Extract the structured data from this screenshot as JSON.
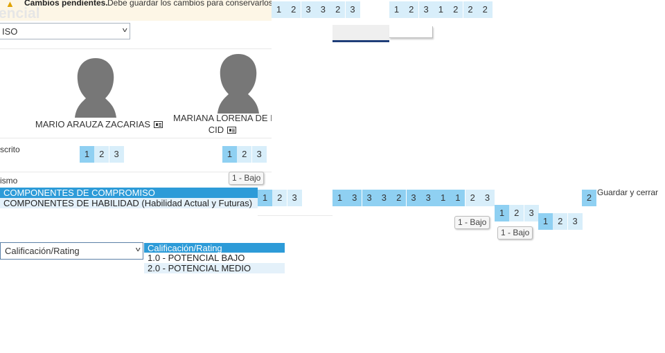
{
  "banner": {
    "warning_icon": "warning-triangle-icon",
    "title": "Cambios pendientes.",
    "message": "Debe guardar los cambios para conservarlos."
  },
  "page": {
    "title_partial": "encial"
  },
  "top_select": {
    "value": "ISO"
  },
  "employees": [
    {
      "name": "MARIO ARAUZA ZACARIAS"
    },
    {
      "name_line1": "MARIANA LORENA DE I",
      "name_line2": "CID"
    }
  ],
  "sections": {
    "row1_label": "scrito",
    "row2_label": "ismo"
  },
  "competency_list": {
    "items": [
      {
        "label": "COMPONENTES DE COMPROMISO",
        "selected": true
      },
      {
        "label": "COMPONENTES DE HABILIDAD (Habilidad Actual y Futuras)",
        "selected": false
      }
    ]
  },
  "rating_select": {
    "value": "Calificación/Rating",
    "options": [
      "Calificación/Rating",
      "1.0 - POTENCIAL BAJO",
      "2.0 - POTENCIAL MEDIO"
    ]
  },
  "tooltip": {
    "label": "1 - Bajo"
  },
  "save_close": {
    "label": "Guardar y cerrar"
  },
  "ratings": {
    "top_a": [
      "1",
      "2",
      "3",
      "3",
      "2",
      "3"
    ],
    "top_b": [
      "1",
      "2",
      "3",
      "1",
      "2",
      "2",
      "2"
    ],
    "emp1_row1": [
      "1",
      "2",
      "3"
    ],
    "emp2_row1": [
      "1",
      "2",
      "3"
    ],
    "row3_left": [
      "1",
      "2",
      "3"
    ],
    "row3_mid": [
      "1",
      "3",
      "3",
      "3",
      "2",
      "3",
      "3",
      "1",
      "1",
      "2",
      "3"
    ],
    "row3_right": [
      "2"
    ],
    "row4_a": [
      "1",
      "2",
      "3"
    ],
    "row4_b": [
      "1",
      "2",
      "3"
    ]
  },
  "colors": {
    "selected_blue": "#2d9bd8",
    "cell_dark": "#8fd0f2",
    "cell_light": "#d8eefa"
  }
}
